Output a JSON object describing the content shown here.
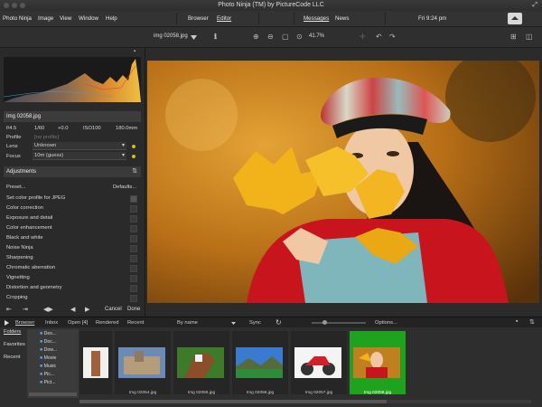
{
  "window": {
    "title": "Photo Ninja (TM) by PictureCode LLC"
  },
  "menu": {
    "items": [
      "Photo Ninja",
      "Image",
      "View",
      "Window",
      "Help"
    ]
  },
  "modes": {
    "browser": "Browser",
    "editor": "Editor"
  },
  "news": {
    "messages": "Messages",
    "news": "News"
  },
  "clock": "Fri 9:24 pm",
  "toolbar": {
    "filename": "img 02058.jpg",
    "zoom": "41.7%"
  },
  "file": {
    "name": "Img 02058.jpg",
    "exif": {
      "aperture": "f/4.5",
      "shutter": "1/60",
      "ev": "+0.0",
      "iso": "ISO100",
      "focal": "180.0mm"
    },
    "profile_label": "Profile",
    "profile_value": "[no profile]",
    "lens_label": "Lens",
    "lens_value": "Unknown",
    "focus_label": "Focus",
    "focus_value": "10m (guess)"
  },
  "adjustments": {
    "title": "Adjustments",
    "preset": "Preset...",
    "defaults": "Defaults...",
    "items": [
      "Set color profile for JPEG",
      "Color correction",
      "Exposure and detail",
      "Color enhancement",
      "Black and white",
      "Noise Ninja",
      "Sharpening",
      "Chromatic aberration",
      "Vignetting",
      "Distortion and geometry",
      "Cropping"
    ],
    "cancel": "Cancel",
    "done": "Done"
  },
  "bottom": {
    "browser": "Browser",
    "inbox": "Inbox",
    "open": "Open [4]",
    "rendered": "Rendered",
    "recent": "Recent",
    "sort": "By name",
    "sync": "Sync",
    "options": "Options..."
  },
  "sidebar": {
    "folders": "Folders",
    "favorites": "Favorites",
    "recent": "Recent"
  },
  "tree": [
    "Des...",
    "Doc...",
    "Dow...",
    "Movie",
    "Music",
    "Pic...",
    "Pict..."
  ],
  "thumbs": [
    "Img 02054.jpg",
    "Img 02055.jpg",
    "Img 02056.jpg",
    "Img 02057.jpg",
    "Img 02058.jpg"
  ],
  "colors": {
    "accent_selected": "#1fa31f",
    "panel": "#2a2a2a",
    "indicator": "#c8c020"
  }
}
